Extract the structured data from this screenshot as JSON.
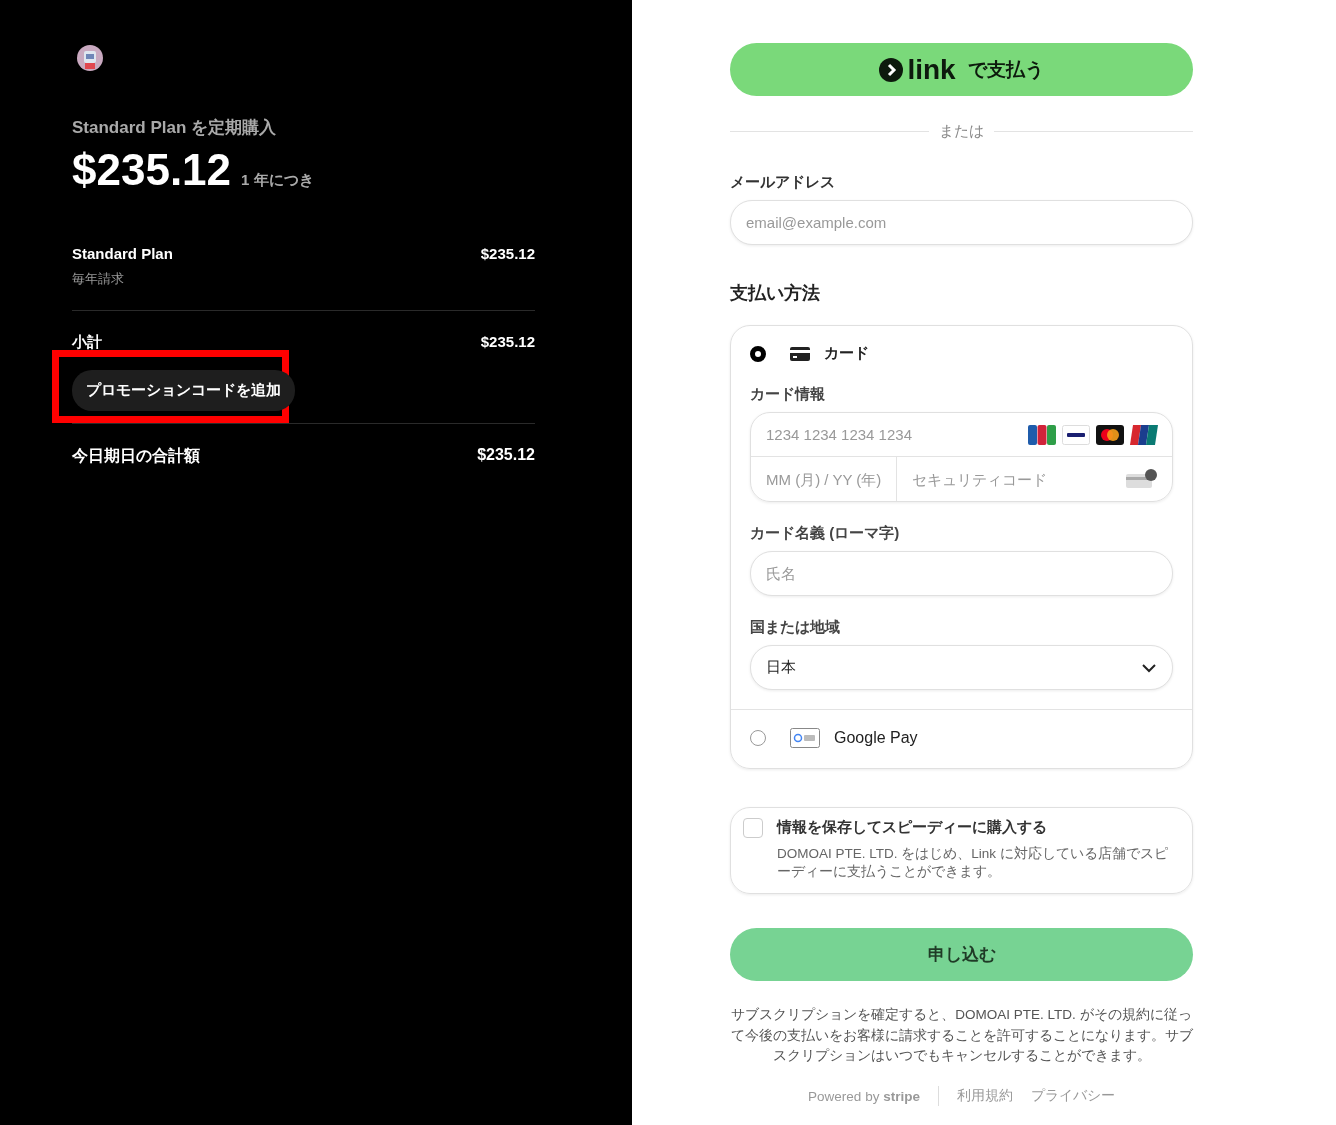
{
  "summary": {
    "title": "Standard Plan を定期購入",
    "price": "$235.12",
    "period": "1 年につき",
    "line_item": {
      "name": "Standard Plan",
      "note": "毎年請求",
      "amount": "$235.12"
    },
    "subtotal": {
      "label": "小計",
      "amount": "$235.12"
    },
    "promo": {
      "label": "プロモーションコードを追加",
      "highlighted": true
    },
    "total": {
      "label": "今日期日の合計額",
      "amount": "$235.12"
    }
  },
  "checkout": {
    "link_button": {
      "brand": "link",
      "label": "で支払う"
    },
    "divider_text": "または",
    "email": {
      "label": "メールアドレス",
      "placeholder": "email@example.com"
    },
    "payment_heading": "支払い方法",
    "methods": [
      {
        "kind": "card",
        "label": "カード",
        "selected": true,
        "card_info_label": "カード情報",
        "number_placeholder": "1234 1234 1234 1234",
        "expiry_placeholder": "MM (月) / YY (年)",
        "cvc_placeholder": "セキュリティコード",
        "name_label": "カード名義 (ローマ字)",
        "name_placeholder": "氏名",
        "country_label": "国または地域",
        "country_value": "日本"
      },
      {
        "kind": "google_pay",
        "label": "Google Pay",
        "selected": false
      }
    ],
    "save_info": {
      "checked": false,
      "title": "情報を保存してスピーディーに購入する",
      "description": "DOMOAI PTE. LTD. をはじめ、Link に対応している店舗でスピーディーに支払うことができます。"
    },
    "submit": "申し込む",
    "terms": "サブスクリプションを確定すると、DOMOAI PTE. LTD. がその規約に従って今後の支払いをお客様に請求することを許可することになります。サブスクリプションはいつでもキャンセルすることができます。",
    "footer": {
      "powered": "Powered by **stripe**",
      "links": [
        "利用規約",
        "プライバシー"
      ]
    }
  }
}
